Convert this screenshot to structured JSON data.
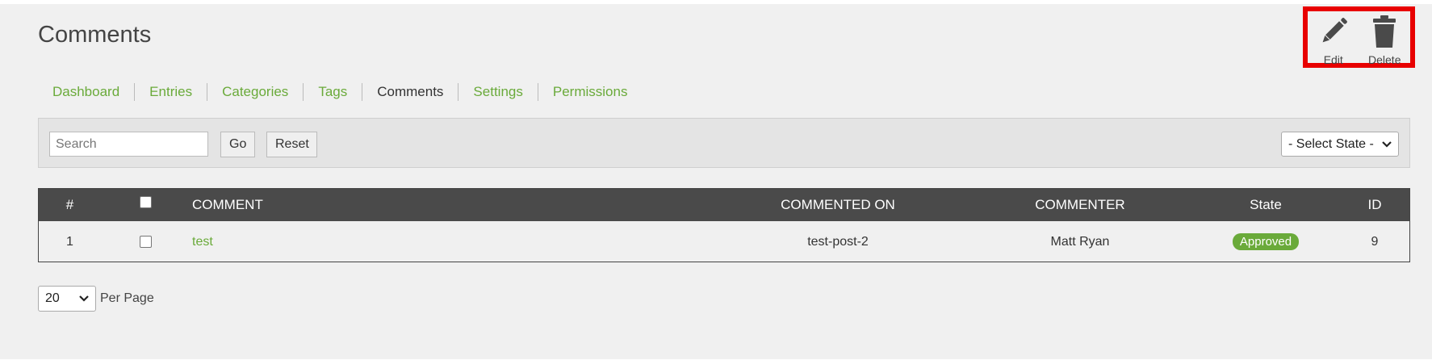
{
  "page": {
    "title": "Comments"
  },
  "toolbar": {
    "edit_label": "Edit",
    "edit_icon": "pencil-icon",
    "delete_label": "Delete",
    "delete_icon": "trash-icon",
    "highlight_color": "#e80000"
  },
  "tabs": [
    {
      "label": "Dashboard",
      "active": false
    },
    {
      "label": "Entries",
      "active": false
    },
    {
      "label": "Categories",
      "active": false
    },
    {
      "label": "Tags",
      "active": false
    },
    {
      "label": "Comments",
      "active": true
    },
    {
      "label": "Settings",
      "active": false
    },
    {
      "label": "Permissions",
      "active": false
    }
  ],
  "filters": {
    "search_placeholder": "Search",
    "search_value": "",
    "go_label": "Go",
    "reset_label": "Reset",
    "state_select_value": "- Select State -"
  },
  "table": {
    "headers": {
      "num": "#",
      "comment": "COMMENT",
      "commented_on": "COMMENTED ON",
      "commenter": "COMMENTER",
      "state": "State",
      "id": "ID"
    },
    "rows": [
      {
        "num": "1",
        "checked": false,
        "comment": "test",
        "commented_on": "test-post-2",
        "commenter": "Matt Ryan",
        "state": "Approved",
        "id": "9"
      }
    ]
  },
  "pagination": {
    "page_size": "20",
    "per_page_label": "Per Page"
  },
  "colors": {
    "accent": "#6aaa3a",
    "header_bg": "#4a4a4a",
    "page_bg": "#f0f0f0"
  }
}
